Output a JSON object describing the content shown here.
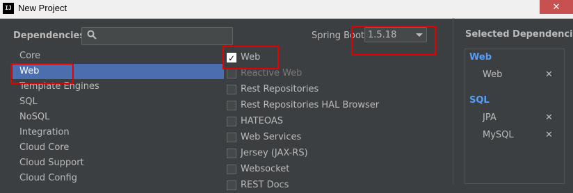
{
  "window": {
    "title": "New Project",
    "close_label": "✕",
    "app_icon_text": "IJ"
  },
  "dependencies_label": "Dependencies",
  "search": {
    "value": "",
    "placeholder": ""
  },
  "spring_boot": {
    "label": "Spring Boot",
    "version": "1.5.18"
  },
  "categories": [
    "Core",
    "Web",
    "Template Engines",
    "SQL",
    "NoSQL",
    "Integration",
    "Cloud Core",
    "Cloud Support",
    "Cloud Config"
  ],
  "selected_category": "Web",
  "deps": [
    {
      "label": "Web",
      "checked": true,
      "enabled": true
    },
    {
      "label": "Reactive Web",
      "checked": false,
      "enabled": false
    },
    {
      "label": "Rest Repositories",
      "checked": false,
      "enabled": true
    },
    {
      "label": "Rest Repositories HAL Browser",
      "checked": false,
      "enabled": true
    },
    {
      "label": "HATEOAS",
      "checked": false,
      "enabled": true
    },
    {
      "label": "Web Services",
      "checked": false,
      "enabled": true
    },
    {
      "label": "Jersey (JAX-RS)",
      "checked": false,
      "enabled": true
    },
    {
      "label": "Websocket",
      "checked": false,
      "enabled": true
    },
    {
      "label": "REST Docs",
      "checked": false,
      "enabled": true
    }
  ],
  "selected_deps": {
    "title": "Selected Dependencies",
    "groups": [
      {
        "name": "Web",
        "items": [
          "Web"
        ]
      },
      {
        "name": "SQL",
        "items": [
          "JPA",
          "MySQL"
        ]
      }
    ],
    "remove_glyph": "✕"
  },
  "colors": {
    "background": "#3c3f41",
    "selection": "#4b6eaf",
    "group_heading": "#589df6",
    "annotation": "#e60000"
  }
}
